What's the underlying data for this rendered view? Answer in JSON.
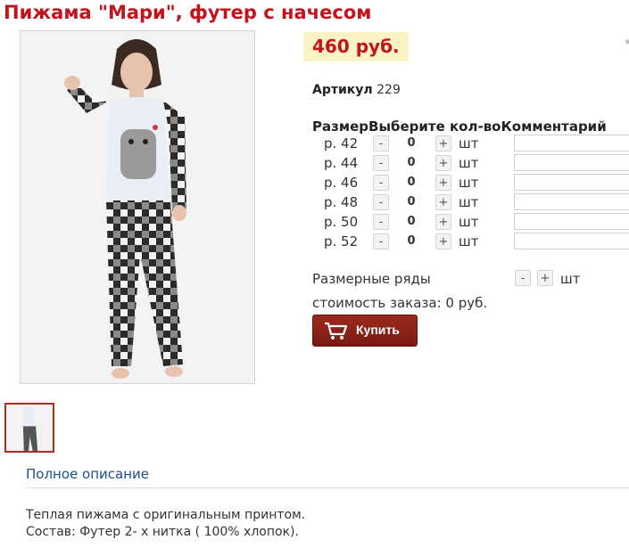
{
  "product": {
    "title": "Пижама \"Мари\", футер с начесом",
    "price": "460 руб.",
    "article_label": "Артикул",
    "article_value": "229"
  },
  "order_table": {
    "headers": [
      "Размер",
      "Выберите кол-во",
      "Комментарий"
    ],
    "rows": [
      {
        "size": "р. 42",
        "qty": "0",
        "unit": "шт"
      },
      {
        "size": "р. 44",
        "qty": "0",
        "unit": "шт"
      },
      {
        "size": "р. 46",
        "qty": "0",
        "unit": "шт"
      },
      {
        "size": "р. 48",
        "qty": "0",
        "unit": "шт"
      },
      {
        "size": "р. 50",
        "qty": "0",
        "unit": "шт"
      },
      {
        "size": "р. 52",
        "qty": "0",
        "unit": "шт"
      }
    ],
    "minus": "-",
    "plus": "+"
  },
  "size_grid": {
    "label": "Размерные ряды",
    "minus": "-",
    "plus": "+",
    "unit": "шт"
  },
  "total": "стоимость заказа: 0 руб.",
  "buy_button": "Купить",
  "tabs": {
    "full_description": "Полное описание"
  },
  "description": {
    "line1": "Теплая пижама с оригинальным принтом.",
    "line2": "Состав: Футер 2- х нитка ( 100% хлопок)."
  },
  "colors": {
    "title": "#c3141b",
    "price_bg": "#fbf3c4",
    "button": "#8b2218",
    "link": "#1d4f8a"
  }
}
